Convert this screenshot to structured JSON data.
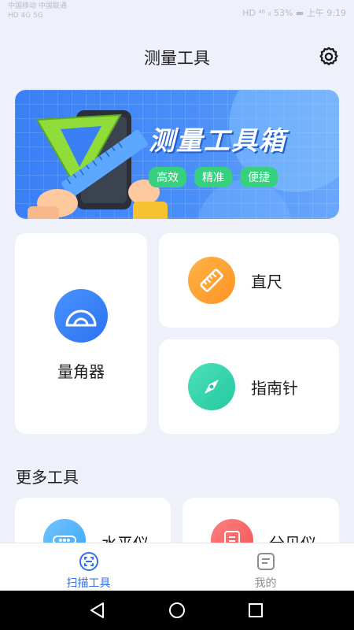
{
  "status_bar": {
    "left_line1": "中国移动 中国联通",
    "left_line2": "HD 4G 5G",
    "right": "HD  ⁴⁶ ᵢₗ  53% ▬  上午 9:19"
  },
  "header": {
    "title": "测量工具",
    "settings_icon": "gear-icon"
  },
  "banner": {
    "headline": "测量工具箱",
    "tags": [
      "高效",
      "精准",
      "便捷"
    ],
    "colors": {
      "bg": "#3a7ff5",
      "tag": "#36d07f"
    }
  },
  "tools": {
    "protractor": {
      "label": "量角器",
      "icon": "protractor-icon"
    },
    "ruler": {
      "label": "直尺",
      "icon": "ruler-icon"
    },
    "compass": {
      "label": "指南针",
      "icon": "compass-icon"
    }
  },
  "more": {
    "title": "更多工具",
    "items": [
      {
        "label": "水平仪",
        "icon": "level-icon"
      },
      {
        "label": "分贝仪",
        "icon": "decibel-icon"
      }
    ]
  },
  "tab_bar": {
    "tabs": [
      {
        "label": "扫描工具",
        "icon": "scan-icon",
        "active": true
      },
      {
        "label": "我的",
        "icon": "profile-doc-icon",
        "active": false
      }
    ],
    "accent": "#2f6fef"
  },
  "nav_bar": {
    "back": "back-icon",
    "home": "home-icon",
    "recents": "recents-icon"
  }
}
